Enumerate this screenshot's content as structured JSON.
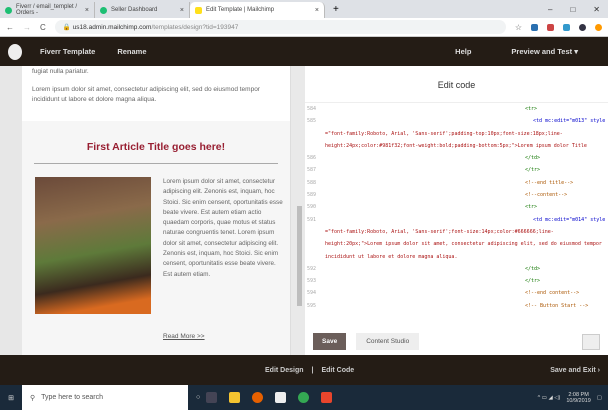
{
  "browser": {
    "tabs": [
      {
        "title": "Fiverr / email_templet / Orders -"
      },
      {
        "title": "Seller Dashboard"
      },
      {
        "title": "Edit Template | Mailchimp",
        "active": true
      }
    ],
    "url_host": "us18.admin.mailchimp.com",
    "url_path": "/templates/design?tid=193947"
  },
  "header": {
    "template_name": "Fiverr Template",
    "rename": "Rename",
    "help": "Help",
    "preview": "Preview and Test ▾"
  },
  "email": {
    "trailing": "fugiat nulla pariatur.",
    "intro": "Lorem ipsum dolor sit amet, consectetur adipiscing elit, sed do eiusmod tempor incididunt ut labore et dolore magna aliqua.",
    "article_title": "First Article Title goes here!",
    "article_body": "Lorem ipsum dolor sit amet, consectetur adipiscing elit. Zenonis est, inquam, hoc Stoici. Sic enim censent, oportunitatis esse beate vivere. Est autem etiam actio quaedam corporis, quae motus et status naturae congruentis tenet. Lorem ipsum dolor sit amet, consectetur adipiscing elit. Zenonis est, inquam, hoc Stoici. Sic enim censent, oportunitatis esse beate vivere. Est autem etiam.",
    "read_more": "Read More >>",
    "title_color": "#981f32"
  },
  "code": {
    "heading": "Edit code",
    "lines": [
      {
        "n": "584",
        "i": "",
        "t": "<tr>",
        "c": "tag"
      },
      {
        "n": "585",
        "i": "",
        "t": "<td mc:edit=\"m013\" style",
        "c": "attr"
      },
      {
        "n": "",
        "i": "",
        "t": "=\"font-family:Roboto, Arial, 'Sans-serif';padding-top:10px;font-size:18px;line-height:24px;color:#981f32;font-weight:bold;padding-bottom:5px;\">Lorem ipsum dolor Title",
        "c": "str"
      },
      {
        "n": "586",
        "i": "",
        "t": "</td>",
        "c": "tag"
      },
      {
        "n": "587",
        "i": "",
        "t": "</tr>",
        "c": "tag"
      },
      {
        "n": "588",
        "i": "",
        "t": "<!--end title-->",
        "c": "cmt"
      },
      {
        "n": "589",
        "i": "",
        "t": "<!--content-->",
        "c": "cmt"
      },
      {
        "n": "590",
        "i": "",
        "t": "<tr>",
        "c": "tag"
      },
      {
        "n": "591",
        "i": "",
        "t": "<td mc:edit=\"m014\" style",
        "c": "attr"
      },
      {
        "n": "",
        "i": "",
        "t": "=\"font-family:Roboto, Arial, 'Sans-serif';font-size:14px;color:#666666;line-height:20px;\">Lorem ipsum dolor sit amet, consectetur adipiscing elit, sed do eiusmod tempor incididunt ut labore et dolore magna aliqua.",
        "c": "str"
      },
      {
        "n": "592",
        "i": "",
        "t": "</td>",
        "c": "tag"
      },
      {
        "n": "593",
        "i": "",
        "t": "</tr>",
        "c": "tag"
      },
      {
        "n": "594",
        "i": "",
        "t": "<!--end content-->",
        "c": "cmt"
      },
      {
        "n": "595",
        "i": "",
        "t": "<!-- Button Start -->",
        "c": "cmt"
      }
    ],
    "save": "Save",
    "content_studio": "Content Studio"
  },
  "footer": {
    "edit_design": "Edit Design",
    "sep": "|",
    "edit_code": "Edit Code",
    "save_exit": "Save and Exit ›"
  },
  "taskbar": {
    "search_placeholder": "Type here to search",
    "time": "2:08 PM",
    "date": "10/9/2019"
  }
}
